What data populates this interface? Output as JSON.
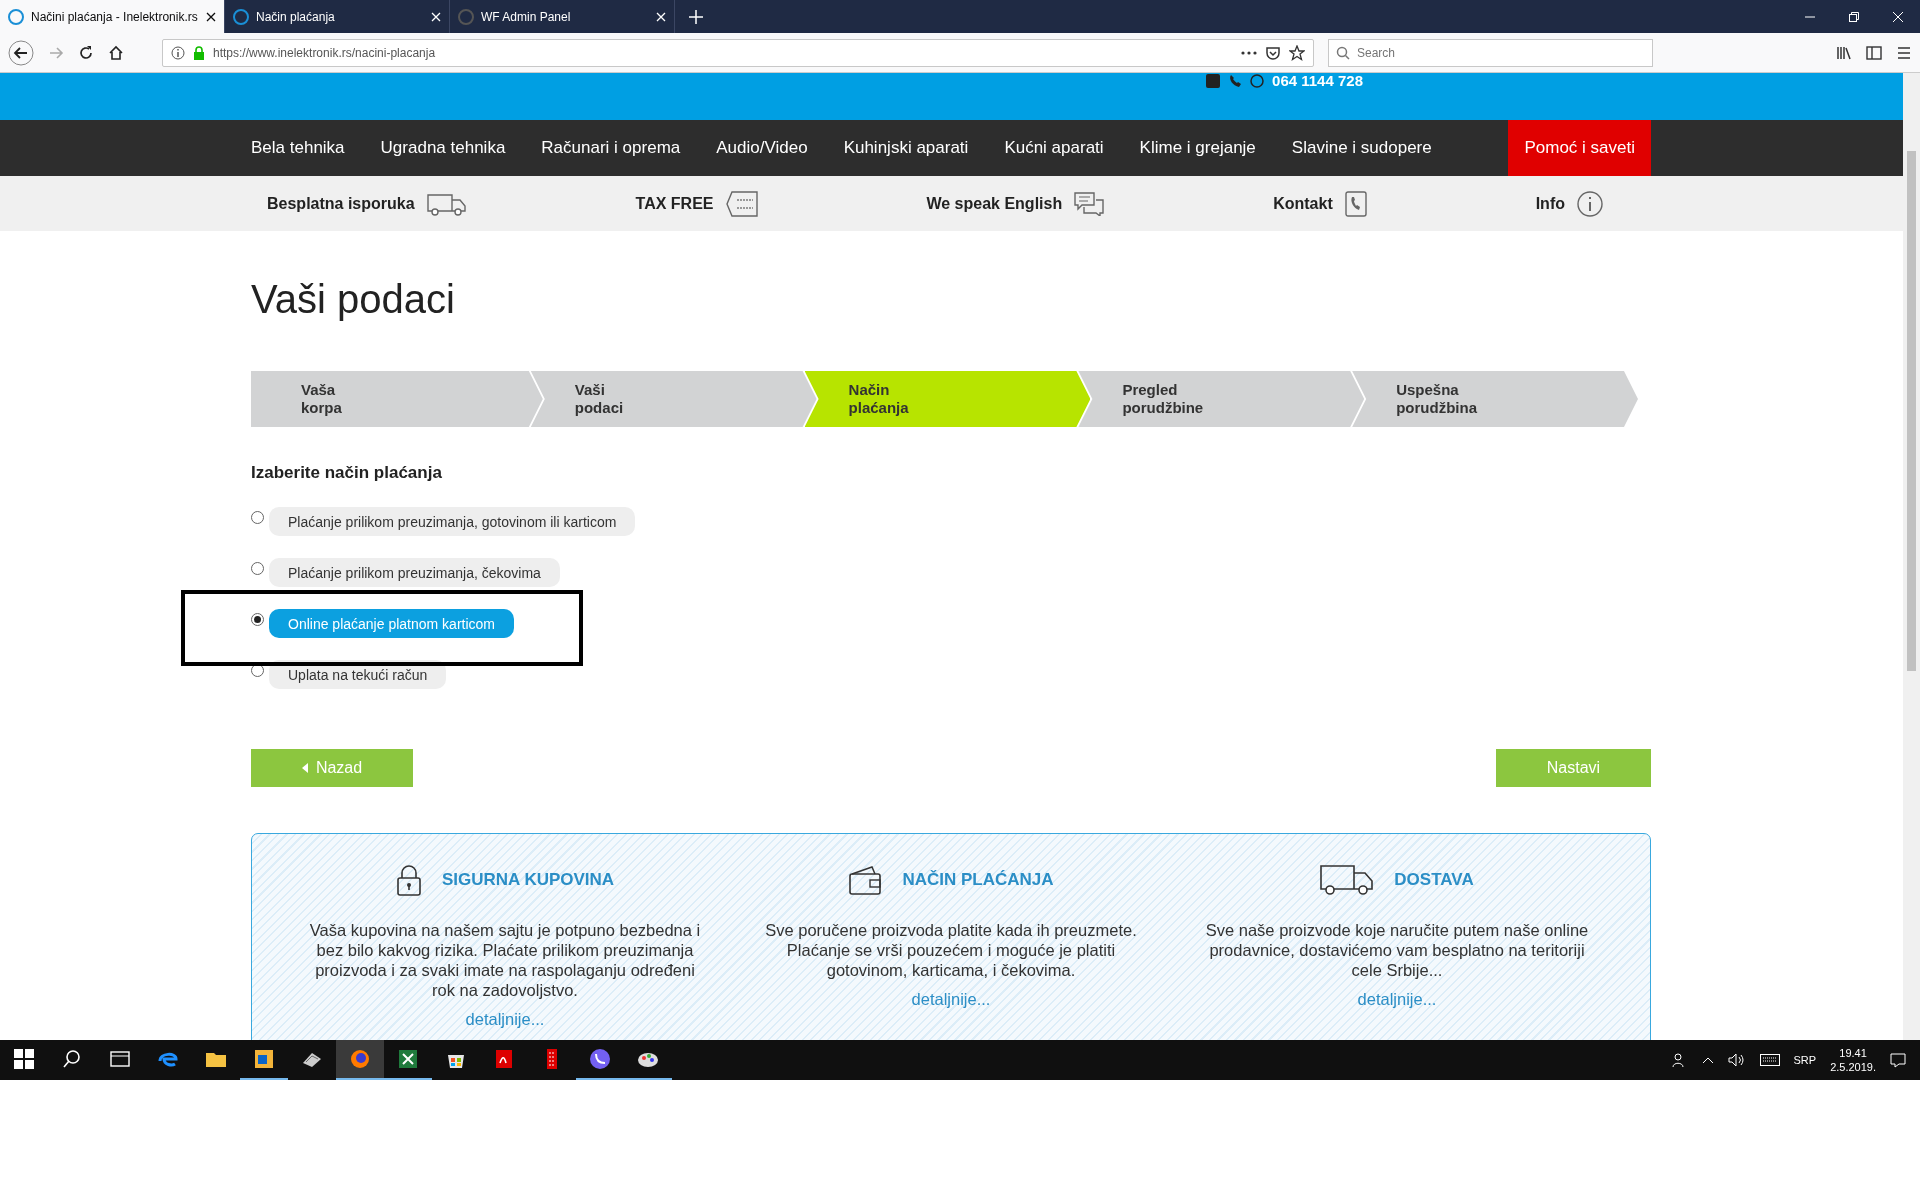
{
  "browser": {
    "tabs": [
      {
        "title": "Načini plaćanja - Inelektronik.rs",
        "selected": true
      },
      {
        "title": "Način plaćanja",
        "selected": false
      },
      {
        "title": "WF Admin Panel",
        "selected": false
      }
    ],
    "address": "https://www.inelektronik.rs/nacini-placanja",
    "search": {
      "placeholder": "Search"
    }
  },
  "header": {
    "phone": "064 1144 728",
    "nav": [
      {
        "label": "Bela tehnika",
        "highlighted": false
      },
      {
        "label": "Ugradna tehnika",
        "highlighted": false
      },
      {
        "label": "Računari i oprema",
        "highlighted": false
      },
      {
        "label": "Audio/Video",
        "highlighted": false
      },
      {
        "label": "Kuhinjski aparati",
        "highlighted": false
      },
      {
        "label": "Kućni aparati",
        "highlighted": false
      },
      {
        "label": "Klime i grejanje",
        "highlighted": false
      },
      {
        "label": "Slavine i sudopere",
        "highlighted": false
      },
      {
        "label": "Pomoć i saveti",
        "highlighted": true
      }
    ],
    "features": [
      {
        "label": "Besplatna isporuka"
      },
      {
        "label": "TAX FREE"
      },
      {
        "label": "We speak English"
      },
      {
        "label": "Kontakt"
      },
      {
        "label": "Info"
      }
    ]
  },
  "page_title": "Vaši podaci",
  "steps": [
    {
      "label": "Vaša korpa",
      "selected": false
    },
    {
      "label": "Vaši podaci",
      "selected": false
    },
    {
      "label": "Način plaćanja",
      "selected": true
    },
    {
      "label": "Pregled porudžbine",
      "selected": false
    },
    {
      "label": "Uspešna porudžbina",
      "selected": false
    }
  ],
  "payment": {
    "heading": "Izaberite način plaćanja",
    "options": [
      {
        "label": "Plaćanje prilikom preuzimanja, gotovinom ili karticom",
        "selected": false,
        "framed": false
      },
      {
        "label": "Plaćanje prilikom preuzimanja, čekovima",
        "selected": false,
        "framed": false
      },
      {
        "label": "Online plaćanje platnom karticom",
        "selected": true,
        "framed": true
      },
      {
        "label": "Uplata na tekući račun",
        "selected": false,
        "framed": false
      }
    ]
  },
  "buttons": {
    "back": "Nazad",
    "next": "Nastavi"
  },
  "info": [
    {
      "title": "SIGURNA KUPOVINA",
      "text": "Vaša kupovina na našem sajtu je potpuno bezbedna i bez bilo kakvog rizika. Plaćate prilikom preuzimanja proizvoda i za svaki imate na raspolaganju određeni rok na zadovoljstvo.",
      "link": "detaljnije..."
    },
    {
      "title": "NAČIN PLAĆANJA",
      "text": "Sve poručene proizvoda platite kada ih preuzmete. Plaćanje se vrši pouzećem i moguće je platiti gotovinom, karticama, i čekovima.",
      "link": "detaljnije..."
    },
    {
      "title": "DOSTAVA",
      "text": "Sve naše proizvode koje naručite putem naše online prodavnice, dostavićemo vam besplatno na teritoriji cele Srbije...",
      "link": "detaljnije..."
    }
  ],
  "taskbar": {
    "apps": [
      {
        "running": false,
        "selected": false
      },
      {
        "running": false,
        "selected": false
      },
      {
        "running": true,
        "selected": false
      },
      {
        "running": false,
        "selected": false
      },
      {
        "running": true,
        "selected": true
      },
      {
        "running": true,
        "selected": false
      },
      {
        "running": false,
        "selected": false
      },
      {
        "running": false,
        "selected": false
      },
      {
        "running": false,
        "selected": false
      },
      {
        "running": true,
        "selected": false
      },
      {
        "running": true,
        "selected": false
      }
    ],
    "language": "SRP",
    "time": "19.41",
    "date": "2.5.2019."
  }
}
